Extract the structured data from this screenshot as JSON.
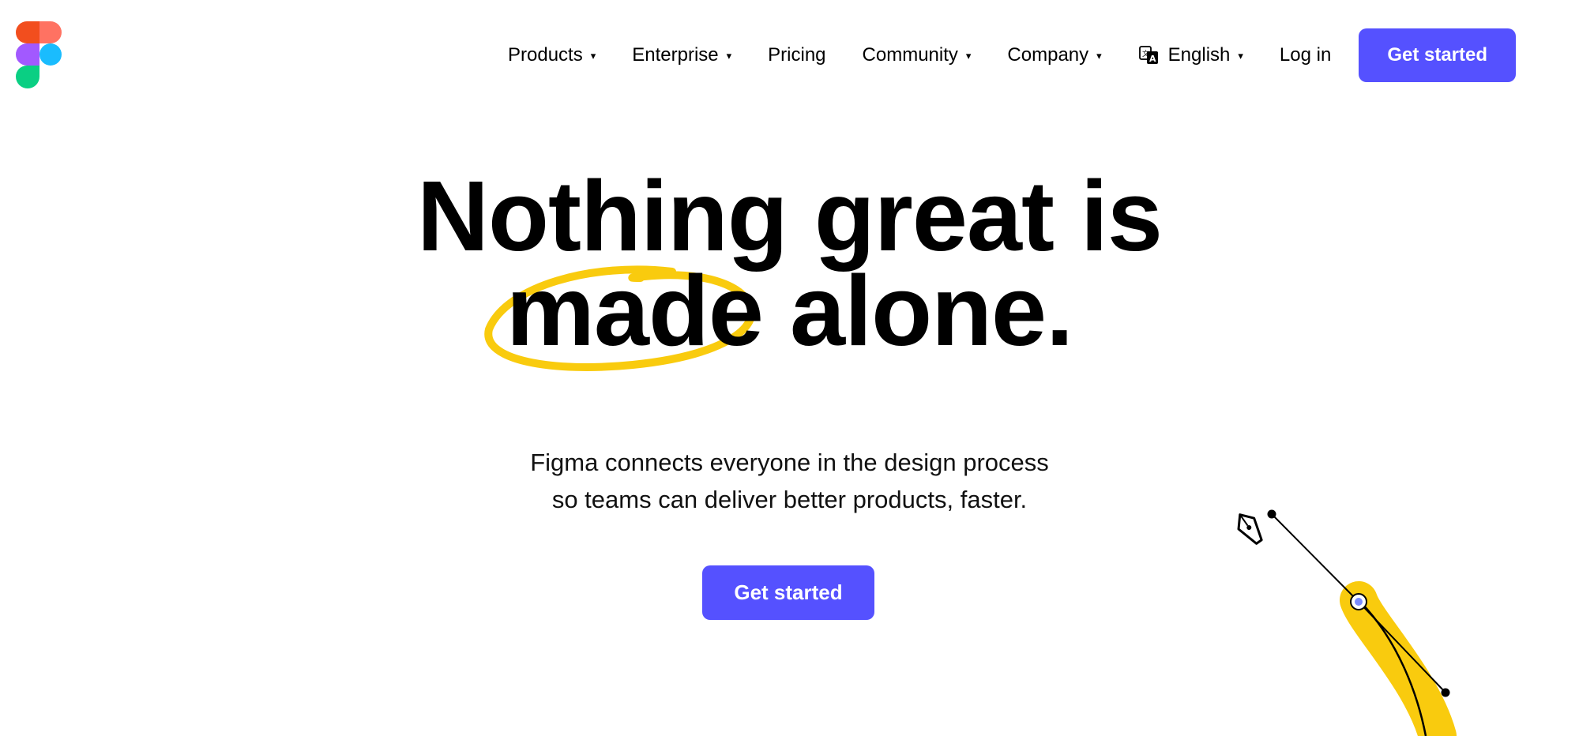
{
  "header": {
    "logo": {
      "icon": "figma-logo-icon",
      "colors": [
        "#f24e1e",
        "#ff7262",
        "#a259ff",
        "#1abcfe",
        "#0acf83"
      ]
    },
    "nav": [
      {
        "label": "Products",
        "has_dropdown": true
      },
      {
        "label": "Enterprise",
        "has_dropdown": true
      },
      {
        "label": "Pricing",
        "has_dropdown": false
      },
      {
        "label": "Community",
        "has_dropdown": true
      },
      {
        "label": "Company",
        "has_dropdown": true
      }
    ],
    "language": {
      "label": "English",
      "icon": "translate-icon"
    },
    "login_label": "Log in",
    "cta_label": "Get started",
    "caret": "▾"
  },
  "hero": {
    "line1": "Nothing great is",
    "line2_circled": "made",
    "line2_rest": " alone.",
    "subtitle_line1": "Figma connects everyone in the design process",
    "subtitle_line2": "so teams can deliver better products, faster.",
    "cta_label": "Get started",
    "accent_color": "#f9cb0e"
  },
  "theme": {
    "primary": "#5551ff"
  }
}
